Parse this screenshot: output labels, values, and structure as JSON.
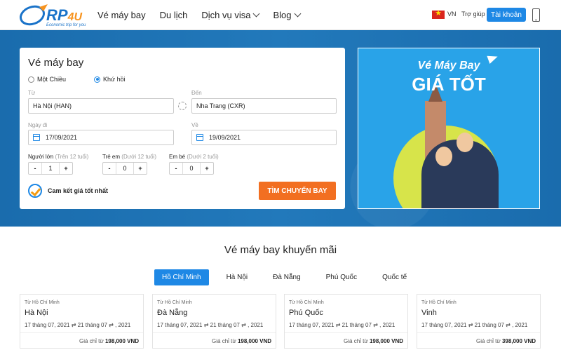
{
  "header": {
    "logo_text": "RP",
    "logo_accent": "4U",
    "logo_tagline": "Economic trip for you",
    "nav": [
      {
        "label": "Vé máy bay",
        "dropdown": false
      },
      {
        "label": "Du lịch",
        "dropdown": false
      },
      {
        "label": "Dịch vụ visa",
        "dropdown": true
      },
      {
        "label": "Blog",
        "dropdown": true
      }
    ],
    "lang": "VN",
    "help": "Trợ giúp",
    "account": "Tài khoản"
  },
  "search": {
    "title": "Vé máy bay",
    "trip_types": [
      {
        "label": "Một Chiều",
        "selected": false
      },
      {
        "label": "Khứ hồi",
        "selected": true
      }
    ],
    "from_label": "Từ",
    "from_value": "Hà Nội (HAN)",
    "to_label": "Đến",
    "to_value": "Nha Trang (CXR)",
    "depart_label": "Ngày đi",
    "depart_value": "17/09/2021",
    "return_label": "Về",
    "return_value": "19/09/2021",
    "adults": {
      "label": "Người lớn",
      "sub": "(Trên 12 tuổi)",
      "value": "1"
    },
    "children": {
      "label": "Trẻ em",
      "sub": "(Dưới 12 tuổi)",
      "value": "0"
    },
    "infants": {
      "label": "Em bé",
      "sub": "(Dưới 2 tuổi)",
      "value": "0"
    },
    "minus": "-",
    "plus": "+",
    "guarantee": "Cam kết giá tốt nhất",
    "submit": "TÌM CHUYẾN BAY"
  },
  "banner": {
    "line1": "Vé Máy Bay",
    "line2": "GIÁ TỐT"
  },
  "promo": {
    "title": "Vé máy bay khuyến mãi",
    "tabs": [
      {
        "label": "Hồ Chí Minh",
        "active": true
      },
      {
        "label": "Hà Nội",
        "active": false
      },
      {
        "label": "Đà Nẵng",
        "active": false
      },
      {
        "label": "Phú Quốc",
        "active": false
      },
      {
        "label": "Quốc tế",
        "active": false
      }
    ],
    "deals": [
      {
        "from": "Từ Hồ Chí Minh",
        "dest": "Hà Nội",
        "dates": "17 tháng 07, 2021  ⇄  21 tháng 07  ⇄  , 2021",
        "price_prefix": "Giá chỉ từ",
        "price": "198,000 VND"
      },
      {
        "from": "Từ Hồ Chí Minh",
        "dest": "Đà Nẵng",
        "dates": "17 tháng 07, 2021  ⇄  21 tháng 07  ⇄  , 2021",
        "price_prefix": "Giá chỉ từ",
        "price": "198,000 VND"
      },
      {
        "from": "Từ Hồ Chí Minh",
        "dest": "Phú Quốc",
        "dates": "17 tháng 07, 2021  ⇄  21 tháng 07  ⇄  , 2021",
        "price_prefix": "Giá chỉ từ",
        "price": "198,000 VND"
      },
      {
        "from": "Từ Hồ Chí Minh",
        "dest": "Vinh",
        "dates": "17 tháng 07, 2021  ⇄  21 tháng 07  ⇄  , 2021",
        "price_prefix": "Giá chỉ từ",
        "price": "398,000 VND"
      }
    ]
  },
  "colors": {
    "primary": "#1e88e5",
    "accent": "#f26f21",
    "hero_bg": "#1f73b4"
  }
}
